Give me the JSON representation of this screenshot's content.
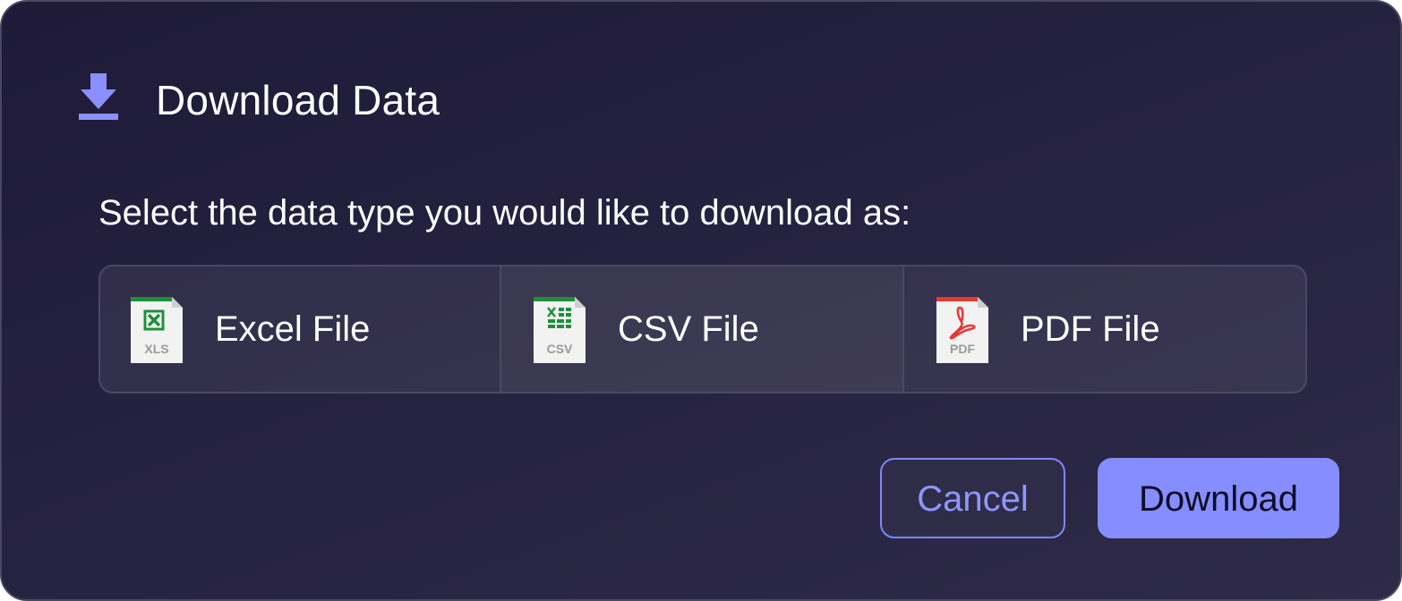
{
  "dialog": {
    "title": "Download Data",
    "icon": "download-icon",
    "prompt": "Select the data type you would like to download as:"
  },
  "options": [
    {
      "label": "Excel File",
      "icon": "xls-file-icon",
      "icon_text": "XLS"
    },
    {
      "label": "CSV File",
      "icon": "csv-file-icon",
      "icon_text": "CSV"
    },
    {
      "label": "PDF File",
      "icon": "pdf-file-icon",
      "icon_text": "PDF"
    }
  ],
  "buttons": {
    "cancel_label": "Cancel",
    "download_label": "Download"
  },
  "colors": {
    "accent": "#868dff",
    "background": "#25223f",
    "excel_green": "#1f8f3a",
    "pdf_red": "#e53935"
  }
}
